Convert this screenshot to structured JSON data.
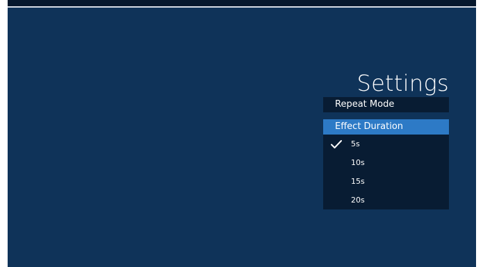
{
  "settings": {
    "title": "Settings",
    "menu": [
      {
        "label": "Repeat Mode"
      },
      {
        "label": "Effect Duration",
        "highlighted": true
      }
    ],
    "effect_duration_options": [
      {
        "label": "5s",
        "selected": true
      },
      {
        "label": "10s",
        "selected": false
      },
      {
        "label": "15s",
        "selected": false
      },
      {
        "label": "20s",
        "selected": false
      }
    ],
    "icons": {
      "selected": "check-icon"
    },
    "colors": {
      "background": "#0f3359",
      "panel": "#081c33",
      "highlight": "#2d7ac6",
      "text": "#ffffff"
    }
  }
}
